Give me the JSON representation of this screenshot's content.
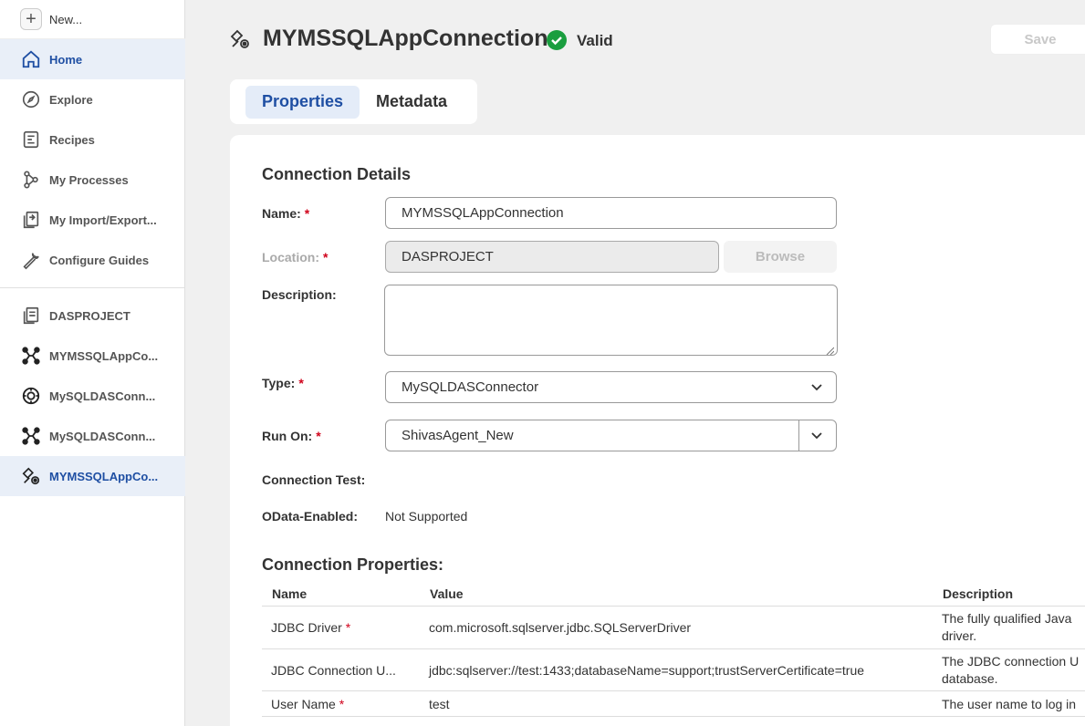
{
  "sidebar": {
    "new_label": "New...",
    "nav": [
      {
        "label": "Home",
        "icon": "home-icon"
      },
      {
        "label": "Explore",
        "icon": "compass-icon"
      },
      {
        "label": "Recipes",
        "icon": "recipe-icon"
      },
      {
        "label": "My Processes",
        "icon": "process-icon"
      },
      {
        "label": "My Import/Export...",
        "icon": "import-export-icon"
      },
      {
        "label": "Configure Guides",
        "icon": "wrench-icon"
      }
    ],
    "recent": [
      {
        "label": "DASPROJECT",
        "icon": "project-icon"
      },
      {
        "label": "MYMSSQLAppCo...",
        "icon": "connection-icon"
      },
      {
        "label": "MySQLDASConn...",
        "icon": "connector-gear-icon"
      },
      {
        "label": "MySQLDASConn...",
        "icon": "connection-icon"
      },
      {
        "label": "MYMSSQLAppCo...",
        "icon": "app-connection-icon"
      }
    ]
  },
  "header": {
    "title": "MYMSSQLAppConnection",
    "status": "Valid",
    "save_label": "Save"
  },
  "tabs": [
    {
      "label": "Properties"
    },
    {
      "label": "Metadata"
    }
  ],
  "details": {
    "title": "Connection Details",
    "name_label": "Name:",
    "name_value": "MYMSSQLAppConnection",
    "location_label": "Location:",
    "location_value": "DASPROJECT",
    "browse_label": "Browse",
    "description_label": "Description:",
    "description_value": "",
    "type_label": "Type:",
    "type_value": "MySQLDASConnector",
    "runon_label": "Run On:",
    "runon_value": "ShivasAgent_New",
    "conn_test_label": "Connection Test:",
    "odata_label": "OData-Enabled:",
    "odata_value": "Not Supported",
    "required_mark": "*"
  },
  "properties": {
    "title": "Connection Properties:",
    "columns": [
      "Name",
      "Value",
      "Description"
    ],
    "rows": [
      {
        "name": "JDBC Driver",
        "required": true,
        "value": "com.microsoft.sqlserver.jdbc.SQLServerDriver",
        "desc1": "The fully qualified Java",
        "desc2": "driver."
      },
      {
        "name": "JDBC Connection U...",
        "required": false,
        "value": "jdbc:sqlserver://test:1433;databaseName=support;trustServerCertificate=true",
        "desc1": "The JDBC connection U",
        "desc2": "database."
      },
      {
        "name": "User Name",
        "required": true,
        "value": "test",
        "desc1": "The user name to log in",
        "desc2": ""
      }
    ]
  },
  "colors": {
    "accent": "#1f4fa3",
    "valid_green": "#1a9e3f",
    "required_red": "#d0021b"
  }
}
